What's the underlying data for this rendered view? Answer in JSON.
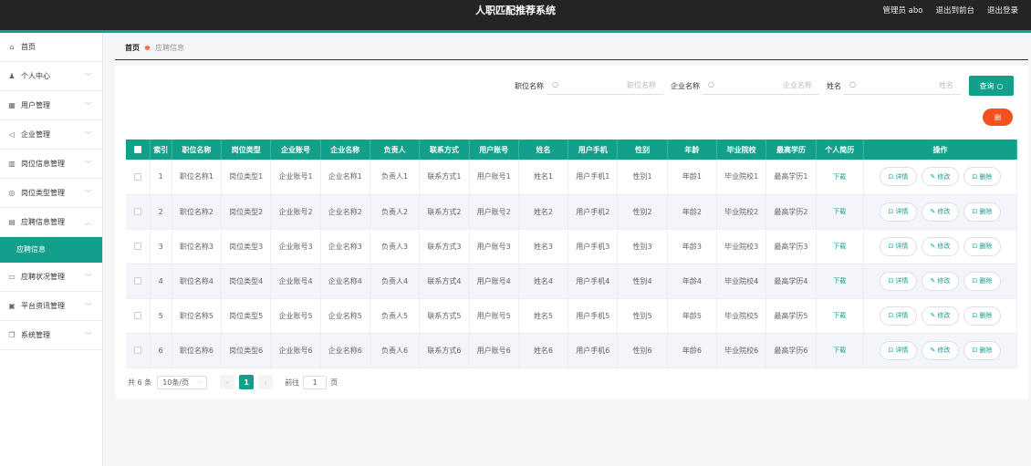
{
  "header": {
    "title": "人职匹配推荐系统",
    "user_label": "管理员 abo",
    "to_front": "退出到前台",
    "logout": "退出登录"
  },
  "sidebar": {
    "items": [
      {
        "label": "首页",
        "icon": "home-icon",
        "has_children": false
      },
      {
        "label": "个人中心",
        "icon": "user-icon",
        "has_children": true
      },
      {
        "label": "用户管理",
        "icon": "grid-icon",
        "has_children": true
      },
      {
        "label": "企业管理",
        "icon": "send-icon",
        "has_children": true
      },
      {
        "label": "岗位信息管理",
        "icon": "chart-icon",
        "has_children": true
      },
      {
        "label": "岗位类型管理",
        "icon": "compass-icon",
        "has_children": true
      },
      {
        "label": "应聘信息管理",
        "icon": "document-icon",
        "has_children": true,
        "expanded": true
      }
    ],
    "active_sub": "应聘信息",
    "items_after": [
      {
        "label": "应聘状况管理",
        "icon": "monitor-icon",
        "has_children": true
      },
      {
        "label": "平台资讯管理",
        "icon": "trash-icon",
        "has_children": true
      },
      {
        "label": "系统管理",
        "icon": "copy-icon",
        "has_children": true
      }
    ]
  },
  "breadcrumb": {
    "home": "首页",
    "current": "应聘信息"
  },
  "search": {
    "fields": [
      {
        "label": "职位名称",
        "placeholder": "职位名称"
      },
      {
        "label": "企业名称",
        "placeholder": "企业名称"
      },
      {
        "label": "姓名",
        "placeholder": "姓名"
      }
    ],
    "query_label": "查询"
  },
  "delete_label": "删",
  "table": {
    "headers": [
      "索引",
      "职位名称",
      "岗位类型",
      "企业账号",
      "企业名称",
      "负责人",
      "联系方式",
      "用户账号",
      "姓名",
      "用户手机",
      "性别",
      "年龄",
      "毕业院校",
      "最高学历",
      "个人简历",
      "操作"
    ],
    "rows": [
      [
        "1",
        "职位名称1",
        "岗位类型1",
        "企业账号1",
        "企业名称1",
        "负责人1",
        "联系方式1",
        "用户账号1",
        "姓名1",
        "用户手机1",
        "性别1",
        "年龄1",
        "毕业院校1",
        "最高学历1",
        "下载"
      ],
      [
        "2",
        "职位名称2",
        "岗位类型2",
        "企业账号2",
        "企业名称2",
        "负责人2",
        "联系方式2",
        "用户账号2",
        "姓名2",
        "用户手机2",
        "性别2",
        "年龄2",
        "毕业院校2",
        "最高学历2",
        "下载"
      ],
      [
        "3",
        "职位名称3",
        "岗位类型3",
        "企业账号3",
        "企业名称3",
        "负责人3",
        "联系方式3",
        "用户账号3",
        "姓名3",
        "用户手机3",
        "性别3",
        "年龄3",
        "毕业院校3",
        "最高学历3",
        "下载"
      ],
      [
        "4",
        "职位名称4",
        "岗位类型4",
        "企业账号4",
        "企业名称4",
        "负责人4",
        "联系方式4",
        "用户账号4",
        "姓名4",
        "用户手机4",
        "性别4",
        "年龄4",
        "毕业院校4",
        "最高学历4",
        "下载"
      ],
      [
        "5",
        "职位名称5",
        "岗位类型5",
        "企业账号5",
        "企业名称5",
        "负责人5",
        "联系方式5",
        "用户账号5",
        "姓名5",
        "用户手机5",
        "性别5",
        "年龄5",
        "毕业院校5",
        "最高学历5",
        "下载"
      ],
      [
        "6",
        "职位名称6",
        "岗位类型6",
        "企业账号6",
        "企业名称6",
        "负责人6",
        "联系方式6",
        "用户账号6",
        "姓名6",
        "用户手机6",
        "性别6",
        "年龄6",
        "毕业院校6",
        "最高学历6",
        "下载"
      ]
    ],
    "actions": {
      "detail": "详情",
      "edit": "修改",
      "delete": "删除"
    }
  },
  "pagination": {
    "total": "共 6 条",
    "page_size": "10条/页",
    "current_page": "1",
    "goto_prefix": "前往",
    "goto_value": "1",
    "goto_suffix": "页"
  },
  "colors": {
    "accent": "#12a08a",
    "topbar": "#222426",
    "danger": "#f4511e"
  }
}
